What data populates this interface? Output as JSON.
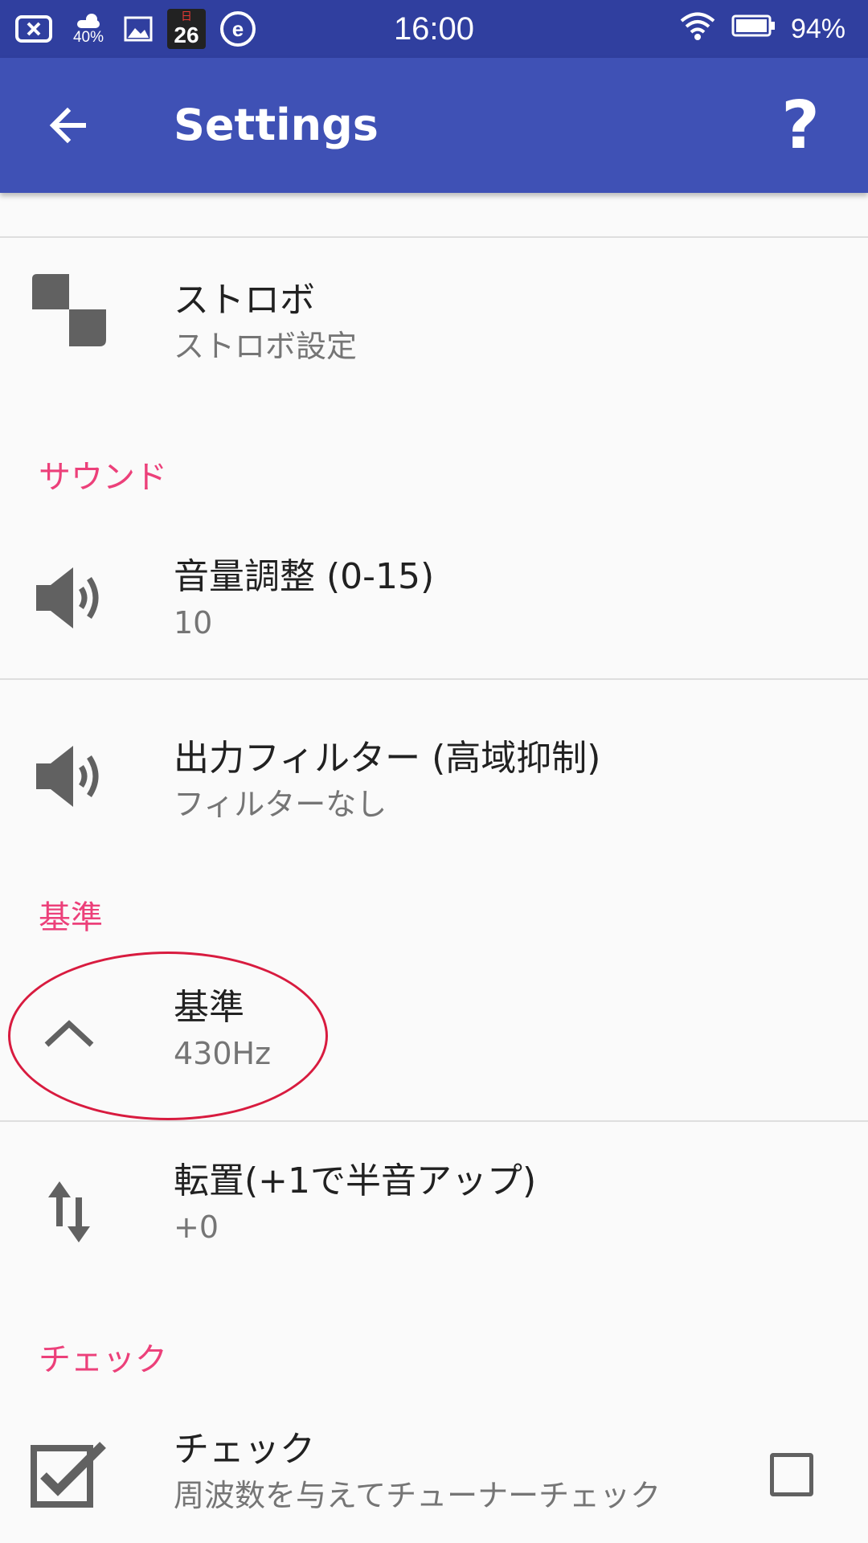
{
  "status_bar": {
    "weather_percent": "40%",
    "calendar_label": "日",
    "calendar_day": "26",
    "e_icon_letter": "e",
    "time": "16:00",
    "battery_percent": "94%"
  },
  "app_bar": {
    "title": "Settings",
    "help_label": "?"
  },
  "items": {
    "strobe": {
      "title": "ストロボ",
      "summary": "ストロボ設定"
    },
    "volume": {
      "title": "音量調整 (0-15)",
      "summary": "10"
    },
    "filter": {
      "title": "出力フィルター (高域抑制)",
      "summary": "フィルターなし"
    },
    "reference": {
      "title": "基準",
      "summary": "430Hz"
    },
    "transpose": {
      "title": "転置(+1で半音アップ)",
      "summary": "+0"
    },
    "check": {
      "title": "チェック",
      "summary": "周波数を与えてチューナーチェック",
      "checked": false
    }
  },
  "categories": {
    "sound": "サウンド",
    "reference": "基準",
    "check": "チェック"
  },
  "colors": {
    "status_bar": "#303f9f",
    "app_bar": "#3f51b5",
    "category_accent": "#ec407a",
    "highlight": "#d81b3f"
  }
}
